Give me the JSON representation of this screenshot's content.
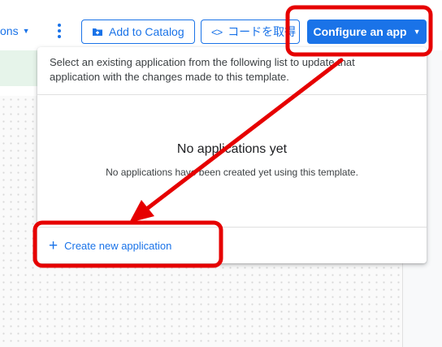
{
  "toolbar": {
    "options_label": "ons",
    "add_catalog_label": "Add to Catalog",
    "code_icon": "<>",
    "code_label": "コードを取得",
    "configure_label": "Configure an app"
  },
  "panel": {
    "description": "Select an existing application from the following list to update that application with the changes made to this template.",
    "empty_title": "No applications yet",
    "empty_subtitle": "No applications have been created yet using this template.",
    "create_label": "Create new application"
  },
  "icons": {
    "caret": "caret-down-icon",
    "kebab": "more-vert-icon",
    "catalog": "add-to-catalog-icon",
    "code": "code-icon",
    "plus": "plus-icon"
  },
  "colors": {
    "accent": "#1a73e8",
    "annotation": "#e60000",
    "banner": "#e6f4ea"
  }
}
